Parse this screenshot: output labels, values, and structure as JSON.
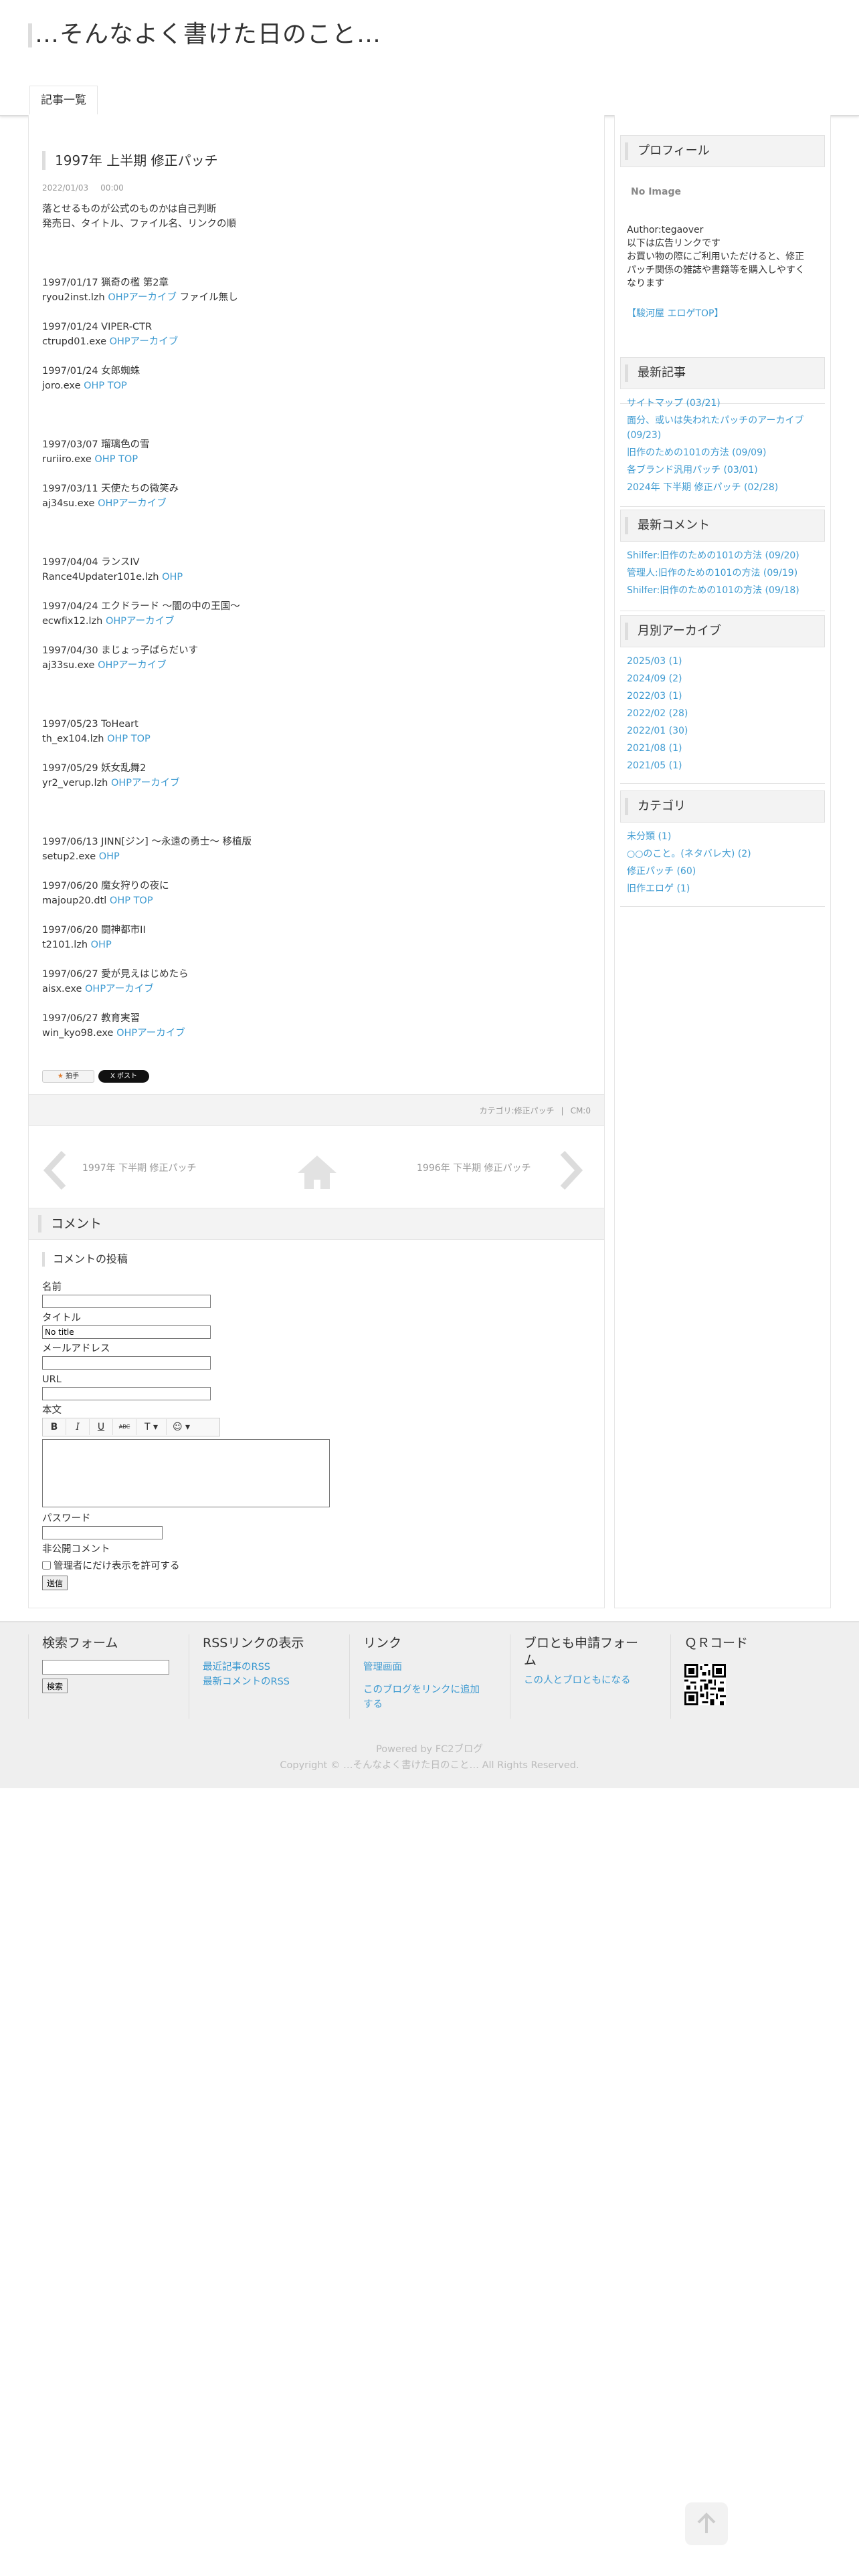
{
  "site": {
    "title": "…そんなよく書けた日のこと…"
  },
  "nav": {
    "tab_label": "記事一覧"
  },
  "entry": {
    "title": "1997年 上半期 修正パッチ",
    "date": "2022/01/03",
    "time": "00:00",
    "intro": [
      "落とせるものが公式のものかは自己判断",
      "発売日、タイトル、ファイル名、リンクの順"
    ],
    "items": [
      {
        "date_title": "1997/01/17 猟奇の檻 第2章",
        "file": "ryou2inst.lzh",
        "links": [
          "OHPアーカイブ"
        ],
        "tail": "ファイル無し",
        "gap": 3
      },
      {
        "date_title": "1997/01/24 VIPER-CTR",
        "file": "ctrupd01.exe",
        "links": [
          "OHPアーカイブ"
        ],
        "tail": "",
        "gap": 1
      },
      {
        "date_title": "1997/01/24 女郎蜘蛛",
        "file": "joro.exe",
        "links": [
          "OHP TOP"
        ],
        "tail": "",
        "gap": 1
      },
      {
        "date_title": "1997/03/07 瑠璃色の雪",
        "file": "ruriiro.exe",
        "links": [
          "OHP TOP"
        ],
        "tail": "",
        "gap": 3
      },
      {
        "date_title": "1997/03/11 天使たちの微笑み",
        "file": "aj34su.exe",
        "links": [
          "OHPアーカイブ"
        ],
        "tail": "",
        "gap": 1
      },
      {
        "date_title": "1997/04/04 ランスIV",
        "file": "Rance4Updater101e.lzh",
        "links": [
          "OHP"
        ],
        "tail": "",
        "gap": 3
      },
      {
        "date_title": "1997/04/24 エクドラード ～闇の中の王国～",
        "file": "ecwfix12.lzh",
        "links": [
          "OHPアーカイブ"
        ],
        "tail": "",
        "gap": 1
      },
      {
        "date_title": "1997/04/30 まじょっ子ばらだいす",
        "file": "aj33su.exe",
        "links": [
          "OHPアーカイブ"
        ],
        "tail": "",
        "gap": 1
      },
      {
        "date_title": "1997/05/23 ToHeart",
        "file": "th_ex104.lzh",
        "links": [
          "OHP TOP"
        ],
        "tail": "",
        "gap": 3
      },
      {
        "date_title": "1997/05/29 妖女乱舞2",
        "file": "yr2_verup.lzh",
        "links": [
          "OHPアーカイブ"
        ],
        "tail": "",
        "gap": 1
      },
      {
        "date_title": "1997/06/13 JINN[ジン] ～永遠の勇士～ 移植版",
        "file": "setup2.exe",
        "links": [
          "OHP"
        ],
        "tail": "",
        "gap": 3
      },
      {
        "date_title": "1997/06/20 魔女狩りの夜に",
        "file": "majoup20.dtl",
        "links": [
          "OHP TOP"
        ],
        "tail": "",
        "gap": 1
      },
      {
        "date_title": "1997/06/20 闘神都市II",
        "file": "t2101.lzh",
        "links": [
          "OHP"
        ],
        "tail": "",
        "gap": 1
      },
      {
        "date_title": "1997/06/27 愛が見えはじめたら",
        "file": "aisx.exe",
        "links": [
          "OHPアーカイブ"
        ],
        "tail": "",
        "gap": 1
      },
      {
        "date_title": "1997/06/27 教育実習",
        "file": "win_kyo98.exe",
        "links": [
          "OHPアーカイブ"
        ],
        "tail": "",
        "gap": 1
      }
    ],
    "like_label": "拍手",
    "post_label": "X ポスト",
    "category": "カテゴリ:修正パッチ",
    "cm": "CM:0"
  },
  "pager": {
    "prev": "1997年 下半期 修正パッチ",
    "next": "1996年 下半期 修正パッチ"
  },
  "comments": {
    "heading": "コメント",
    "form_title": "コメントの投稿",
    "name_label": "名前",
    "title_label": "タイトル",
    "title_value": "No title",
    "mail_label": "メールアドレス",
    "url_label": "URL",
    "body_label": "本文",
    "toolbar": [
      "B",
      "I",
      "U",
      "ABC",
      "T ▾",
      "☺ ▾"
    ],
    "password_label": "パスワード",
    "private_label": "非公開コメント",
    "private_checkbox": "管理者にだけ表示を許可する",
    "submit": "送信"
  },
  "sidebar": {
    "profile": {
      "title": "プロフィール",
      "no_image": "No Image",
      "author": "Author:tegaover",
      "desc": [
        "以下は広告リンクです",
        "お買い物の際にご利用いただけると、修正",
        "パッチ関係の雑誌や書籍等を購入しやすく",
        "なります"
      ],
      "link": "【駿河屋 エロゲTOP】"
    },
    "recent": {
      "title": "最新記事",
      "items": [
        "サイトマップ (03/21)",
        "面分、或いは失われたパッチのアーカイブ",
        "(09/23)",
        "旧作のための101の方法 (09/09)",
        "各ブランド汎用パッチ (03/01)",
        "2024年 下半期 修正パッチ (02/28)"
      ]
    },
    "comments": {
      "title": "最新コメント",
      "items": [
        "Shilfer:旧作のための101の方法 (09/20)",
        "管理人:旧作のための101の方法 (09/19)",
        "Shilfer:旧作のための101の方法 (09/18)"
      ]
    },
    "archive": {
      "title": "月別アーカイブ",
      "items": [
        "2025/03 (1)",
        "2024/09 (2)",
        "2022/03 (1)",
        "2022/02 (28)",
        "2022/01 (30)",
        "2021/08 (1)",
        "2021/05 (1)"
      ]
    },
    "category": {
      "title": "カテゴリ",
      "items": [
        "未分類 (1)",
        "○○のこと。(ネタバレ大) (2)",
        "修正パッチ (60)",
        "旧作エロゲ (1)"
      ]
    }
  },
  "footer": {
    "search_title": "検索フォーム",
    "search_btn": "検索",
    "rss_title": "RSSリンクの表示",
    "rss_links": [
      "最近記事のRSS",
      "最新コメントのRSS"
    ],
    "link_title": "リンク",
    "links": [
      "管理画面",
      "このブログをリンクに追加",
      "する"
    ],
    "friend_title_1": "ブロとも申請フォー",
    "friend_title_2": "ム",
    "friend_link": "この人とブロともになる",
    "qr_title": "ＱＲコード",
    "powered": "Powered by FC2ブログ",
    "copyright": "Copyright © …そんなよく書けた日のこと… All Rights Reserved."
  }
}
